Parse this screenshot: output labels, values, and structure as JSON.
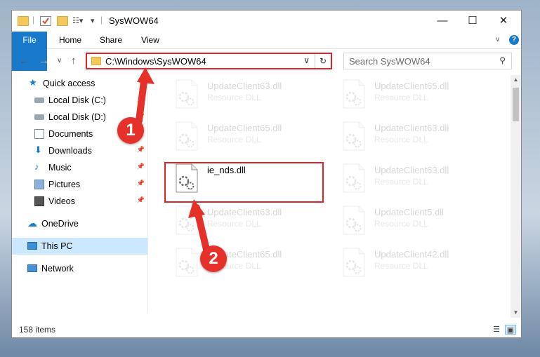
{
  "window": {
    "title": "SysWOW64"
  },
  "ribbon": {
    "tabs": [
      "File",
      "Home",
      "Share",
      "View"
    ],
    "help_glyph": "?"
  },
  "address": {
    "path": "C:\\Windows\\SysWOW64"
  },
  "search": {
    "placeholder": "Search SysWOW64"
  },
  "nav": {
    "items": [
      {
        "label": "Quick access",
        "icon": "star-icon",
        "pinned": false
      },
      {
        "label": "Local Disk (C:)",
        "icon": "drive-icon",
        "pinned": true
      },
      {
        "label": "Local Disk (D:)",
        "icon": "drive-icon",
        "pinned": true
      },
      {
        "label": "Documents",
        "icon": "documents-icon",
        "pinned": true
      },
      {
        "label": "Downloads",
        "icon": "download-icon",
        "pinned": true
      },
      {
        "label": "Music",
        "icon": "music-icon",
        "pinned": true
      },
      {
        "label": "Pictures",
        "icon": "pictures-icon",
        "pinned": true
      },
      {
        "label": "Videos",
        "icon": "videos-icon",
        "pinned": true
      },
      {
        "label": "OneDrive",
        "icon": "cloud-icon",
        "pinned": false
      },
      {
        "label": "This PC",
        "icon": "computer-icon",
        "pinned": false
      },
      {
        "label": "Network",
        "icon": "network-icon",
        "pinned": false
      }
    ]
  },
  "files": [
    {
      "name": "UpdateClient63.dll",
      "type": "Resource DLL",
      "faded": true
    },
    {
      "name": "UpdateClient65.dll",
      "type": "Resource DLL",
      "faded": true
    },
    {
      "name": "UpdateClient65.dll",
      "type": "Resource DLL",
      "faded": true
    },
    {
      "name": "UpdateClient63.dll",
      "type": "Resource DLL",
      "faded": true
    },
    {
      "name": "ie_nds.dll",
      "type": "",
      "faded": false
    },
    {
      "name": "UpdateClient63.dll",
      "type": "Resource DLL",
      "faded": true
    },
    {
      "name": "UpdateClient63.dll",
      "type": "Resource DLL",
      "faded": true
    },
    {
      "name": "UpdateClient5.dll",
      "type": "Resource DLL",
      "faded": true
    },
    {
      "name": "UpdateClient65.dll",
      "type": "Resource DLL",
      "faded": true
    },
    {
      "name": "UpdateClient42.dll",
      "type": "Resource DLL",
      "faded": true
    }
  ],
  "status": {
    "item_count": "158 items"
  },
  "callouts": [
    "1",
    "2"
  ],
  "colors": {
    "accent": "#1979ca",
    "highlight": "#e0232b",
    "selected": "#cce8ff"
  }
}
